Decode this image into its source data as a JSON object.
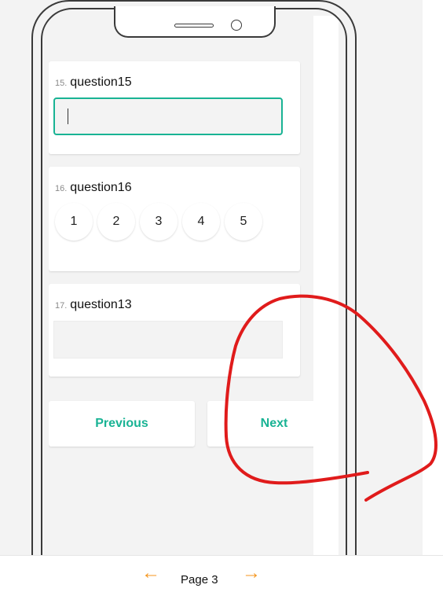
{
  "questions": [
    {
      "number": "15.",
      "title": "question15"
    },
    {
      "number": "16.",
      "title": "question16",
      "rating": [
        "1",
        "2",
        "3",
        "4",
        "5"
      ]
    },
    {
      "number": "17.",
      "title": "question13"
    }
  ],
  "nav": {
    "previous": "Previous",
    "next": "Next"
  },
  "pager": {
    "label": "Page 3",
    "prev_icon": "←",
    "next_icon": "→"
  },
  "colors": {
    "accent": "#19b394",
    "arrow": "#f5961e",
    "annotation": "#e01b1b"
  }
}
